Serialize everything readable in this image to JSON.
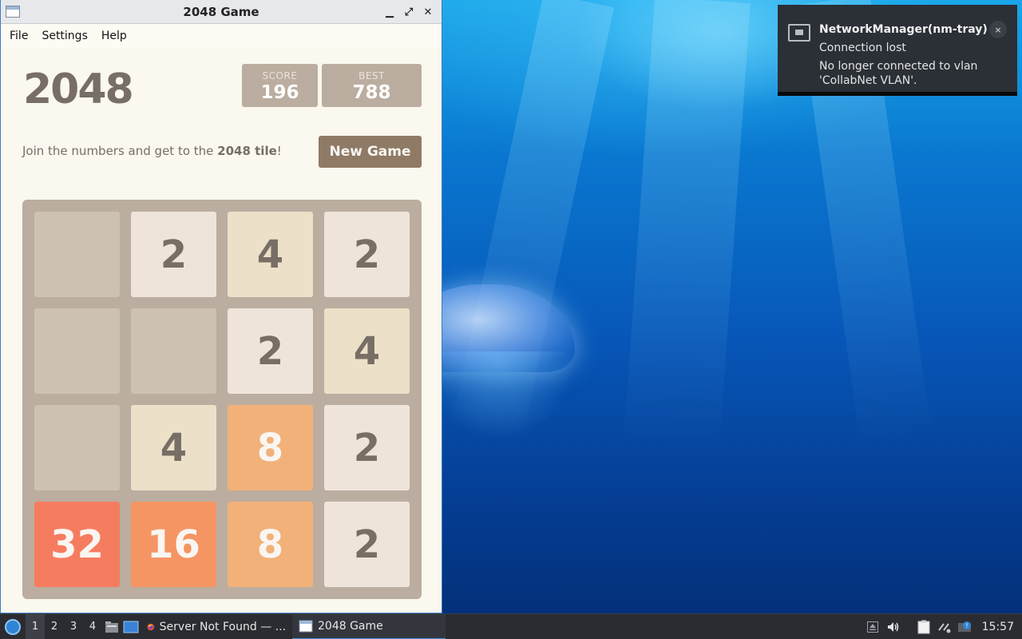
{
  "window": {
    "title": "2048 Game",
    "controls": {
      "minimize": "▁",
      "maximize": "⤢",
      "close": "✕"
    },
    "menu": [
      "File",
      "Settings",
      "Help"
    ]
  },
  "game": {
    "title": "2048",
    "score_label": "SCORE",
    "score": "196",
    "best_label": "BEST",
    "best": "788",
    "intro_prefix": "Join the numbers and get to the ",
    "intro_bold": "2048 tile",
    "intro_suffix": "!",
    "new_game_label": "New Game",
    "grid": [
      [
        "",
        "2",
        "4",
        "2"
      ],
      [
        "",
        "",
        "2",
        "4"
      ],
      [
        "",
        "4",
        "8",
        "2"
      ],
      [
        "32",
        "16",
        "8",
        "2"
      ]
    ],
    "tile_colors": {
      "empty": "#cdc1b4",
      "2": "#eee4da",
      "4": "#ede0c8",
      "8": "#f2b179",
      "16": "#f59563",
      "32": "#f67c5f"
    }
  },
  "notification": {
    "app": "NetworkManager(nm-tray)",
    "summary": "Connection lost",
    "body_line1": "No longer connected to vlan",
    "body_line2": "'CollabNet VLAN'.",
    "close": "×",
    "icon": "network-wired-icon"
  },
  "taskbar": {
    "workspaces": [
      "1",
      "2",
      "3",
      "4"
    ],
    "tasks": [
      {
        "label": "Server Not Found — ...",
        "icon": "firefox-icon"
      },
      {
        "label": "2048 Game",
        "icon": "window-icon"
      }
    ],
    "clock": "15:57",
    "tray_icons": [
      "eject-icon",
      "volume-icon",
      "clipboard-icon",
      "network-icon",
      "updates-icon"
    ]
  }
}
